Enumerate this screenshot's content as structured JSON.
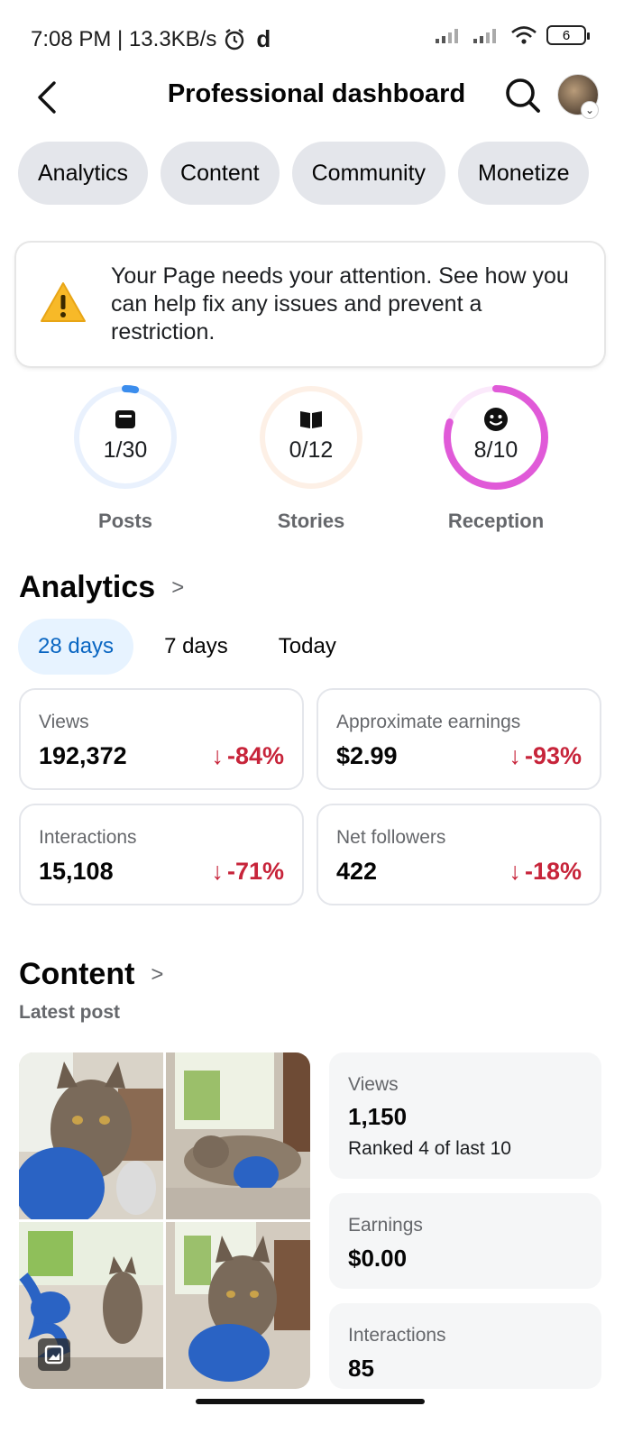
{
  "status_bar": {
    "time_net": "7:08 PM | 13.3KB/s",
    "extra": "d",
    "battery": "6"
  },
  "header": {
    "title": "Professional dashboard"
  },
  "tabs": [
    "Analytics",
    "Content",
    "Community",
    "Monetize"
  ],
  "alert": {
    "text": "Your Page needs your attention. See how you can help fix any issues and prevent a restriction."
  },
  "rings": [
    {
      "label": "Posts",
      "value": "1/30",
      "progress": 0.033,
      "color": "#3b8ded",
      "track": "#e9f1fd",
      "icon": "post-icon"
    },
    {
      "label": "Stories",
      "value": "0/12",
      "progress": 0.0,
      "color": "#f6a05b",
      "track": "#fdf0e6",
      "icon": "book-icon"
    },
    {
      "label": "Reception",
      "value": "8/10",
      "progress": 0.8,
      "color": "#e05ad8",
      "track": "#fbe9fb",
      "icon": "smile-icon"
    }
  ],
  "analytics": {
    "title": "Analytics",
    "ranges": [
      "28 days",
      "7 days",
      "Today"
    ],
    "active_range": "28 days",
    "cards": [
      {
        "label": "Views",
        "value": "192,372",
        "delta": "-84%"
      },
      {
        "label": "Approximate earnings",
        "value": "$2.99",
        "delta": "-93%"
      },
      {
        "label": "Interactions",
        "value": "15,108",
        "delta": "-71%"
      },
      {
        "label": "Net followers",
        "value": "422",
        "delta": "-18%"
      }
    ]
  },
  "content": {
    "title": "Content",
    "subtitle": "Latest post",
    "stats": [
      {
        "label": "Views",
        "value": "1,150",
        "sub": "Ranked 4 of last 10"
      },
      {
        "label": "Earnings",
        "value": "$0.00"
      },
      {
        "label": "Interactions",
        "value": "85"
      }
    ]
  },
  "colors": {
    "accent": "#0a66c2",
    "negative": "#c7243a",
    "chip_bg": "#e4e6eb"
  }
}
